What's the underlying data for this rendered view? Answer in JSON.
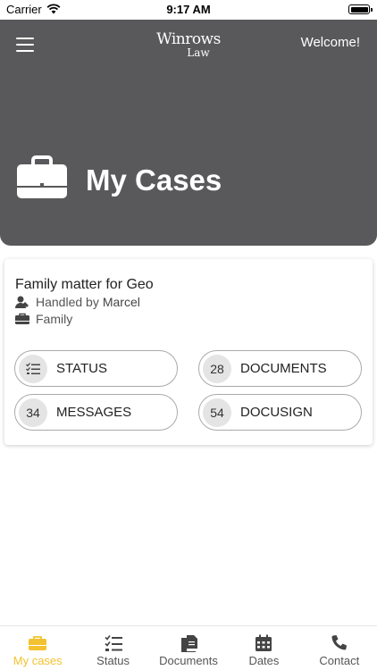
{
  "status_bar": {
    "carrier": "Carrier",
    "time": "9:17 AM"
  },
  "header": {
    "logo_line1": "Winrows",
    "logo_line2": "Law",
    "welcome": "Welcome!",
    "title": "My Cases"
  },
  "case": {
    "title": "Family matter for Geo",
    "handled_prefix": "Handled by",
    "handler": "Marcel",
    "category": "Family"
  },
  "actions": [
    {
      "badge": "",
      "label": "STATUS"
    },
    {
      "badge": "28",
      "label": "DOCUMENTS"
    },
    {
      "badge": "34",
      "label": "MESSAGES"
    },
    {
      "badge": "54",
      "label": "DOCUSIGN"
    }
  ],
  "tabs": [
    {
      "label": "My cases",
      "icon": "briefcase-icon",
      "active": true
    },
    {
      "label": "Status",
      "icon": "checklist-icon"
    },
    {
      "label": "Documents",
      "icon": "documents-icon"
    },
    {
      "label": "Dates",
      "icon": "calendar-icon"
    },
    {
      "label": "Contact",
      "icon": "phone-icon"
    }
  ],
  "colors": {
    "header_bg": "#59595b",
    "accent": "#f3c230"
  }
}
